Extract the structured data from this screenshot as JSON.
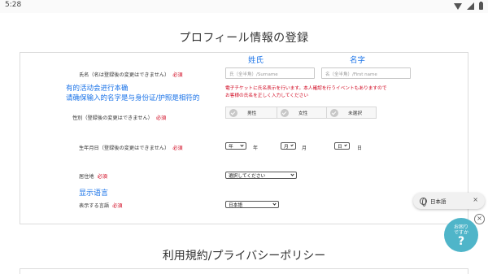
{
  "status_bar": {
    "time": "5:28"
  },
  "page_title": "プロフィール情報の登録",
  "form": {
    "name_label": "氏名（名は登録後の変更はできません）",
    "required": "必須",
    "surname_col_caption": "姓氏",
    "firstname_col_caption": "名字",
    "surname_placeholder": "氏（全半角）/Surname",
    "firstname_placeholder": "名（全半角）/First name",
    "note_line1": "有的活动会进行本确",
    "note_line2": "请确保输入的名字是与身份证/护照是相符的",
    "warning_line1": "電子チケットに氏名表示を行います。本人確認を行うイベントもありますので",
    "warning_line2": "お客様の氏名を正しく入力してください",
    "gender_label": "性別（登録後の変更はできません）",
    "gender_options": [
      "男性",
      "女性",
      "未選択"
    ],
    "birthdate_label": "生年月日（登録後の変更はできません）",
    "year_select": "年",
    "year_unit": "年",
    "month_select": "月",
    "month_unit": "月",
    "day_select": "日",
    "day_unit": "日",
    "residence_label": "居住地",
    "residence_select": "選択してください",
    "display_lang_caption": "显示语言",
    "display_lang_label": "表示する言語",
    "display_lang_select": "日本語"
  },
  "section2_title": "利用規約/プライバシーポリシー",
  "lang_widget": {
    "label": "日本語",
    "close": "×"
  },
  "help_badge": {
    "line1": "お困り",
    "line2": "ですか",
    "mark": "?"
  },
  "close_badge": "×",
  "colors": {
    "accent_blue": "#1a73e8",
    "required_red": "#d0021b",
    "help_teal": "#4fb5c9"
  }
}
